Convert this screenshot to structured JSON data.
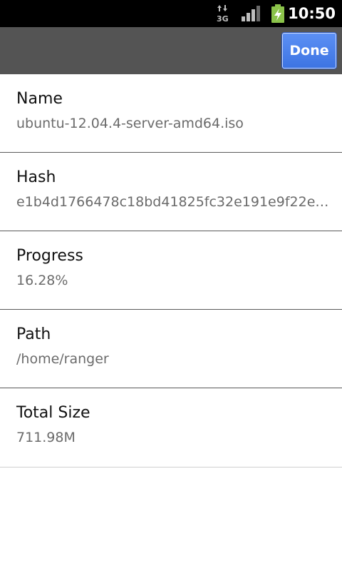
{
  "status_bar": {
    "network_icon": "3g-data-icon",
    "signal_icon": "signal-strength-icon",
    "battery_icon": "battery-charging-icon",
    "time": "10:50"
  },
  "action_bar": {
    "done_label": "Done"
  },
  "details": [
    {
      "label": "Name",
      "value": "ubuntu-12.04.4-server-amd64.iso"
    },
    {
      "label": "Hash",
      "value": "e1b4d1766478c18bd41825fc32e191e9f22e3..."
    },
    {
      "label": "Progress",
      "value": "16.28%"
    },
    {
      "label": "Path",
      "value": "/home/ranger"
    },
    {
      "label": "Total Size",
      "value": "711.98M"
    }
  ],
  "colors": {
    "accent": "#4a82ee",
    "action_bar": "#545454",
    "battery": "#8bc34a"
  }
}
